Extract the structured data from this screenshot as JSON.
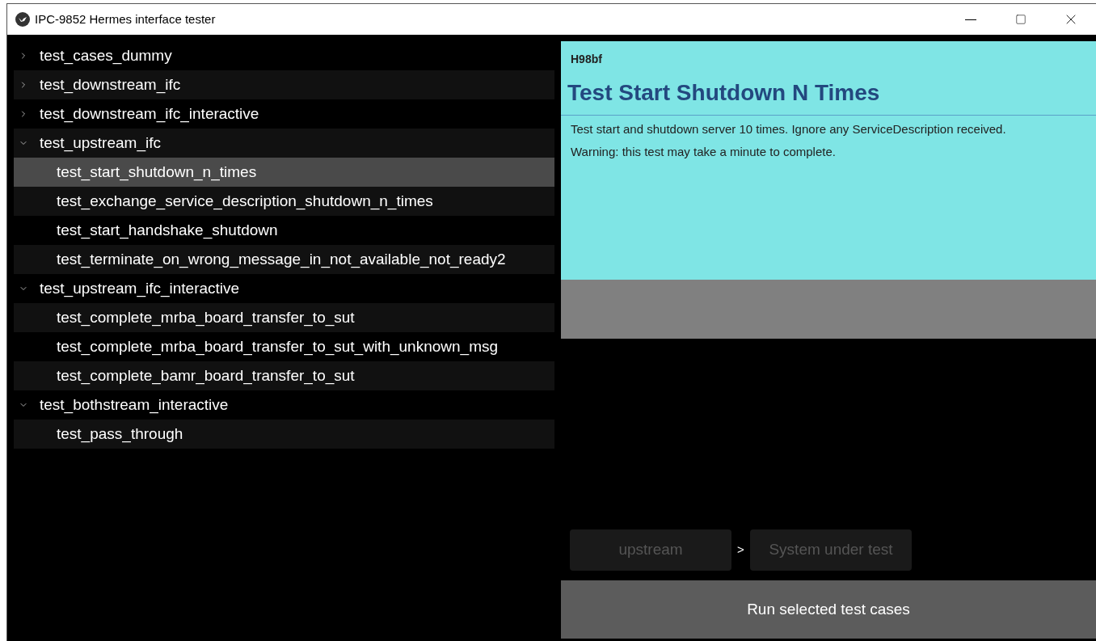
{
  "window": {
    "title": "IPC-9852 Hermes interface tester"
  },
  "tree": [
    {
      "label": "test_cases_dummy",
      "expanded": false
    },
    {
      "label": "test_downstream_ifc",
      "expanded": false
    },
    {
      "label": "test_downstream_ifc_interactive",
      "expanded": false
    },
    {
      "label": "test_upstream_ifc",
      "expanded": true,
      "children": [
        {
          "label": "test_start_shutdown_n_times",
          "selected": true
        },
        {
          "label": "test_exchange_service_description_shutdown_n_times",
          "selected": false
        },
        {
          "label": "test_start_handshake_shutdown",
          "selected": false
        },
        {
          "label": "test_terminate_on_wrong_message_in_not_available_not_ready2",
          "selected": false
        }
      ]
    },
    {
      "label": "test_upstream_ifc_interactive",
      "expanded": true,
      "children": [
        {
          "label": "test_complete_mrba_board_transfer_to_sut",
          "selected": false
        },
        {
          "label": "test_complete_mrba_board_transfer_to_sut_with_unknown_msg",
          "selected": false
        },
        {
          "label": "test_complete_bamr_board_transfer_to_sut",
          "selected": false
        }
      ]
    },
    {
      "label": "test_bothstream_interactive",
      "expanded": true,
      "children": [
        {
          "label": "test_pass_through",
          "selected": false
        }
      ]
    }
  ],
  "details": {
    "id": "H98bf",
    "title": "Test Start Shutdown N Times",
    "lines": [
      "Test start and shutdown server 10 times. Ignore any ServiceDescription received.",
      "Warning: this test may take a minute to complete."
    ]
  },
  "flow": {
    "from": {
      "label": "upstream",
      "disabled": true
    },
    "separator": ">",
    "to": {
      "label": "System under test",
      "disabled": true
    }
  },
  "run_button": "Run selected test cases"
}
